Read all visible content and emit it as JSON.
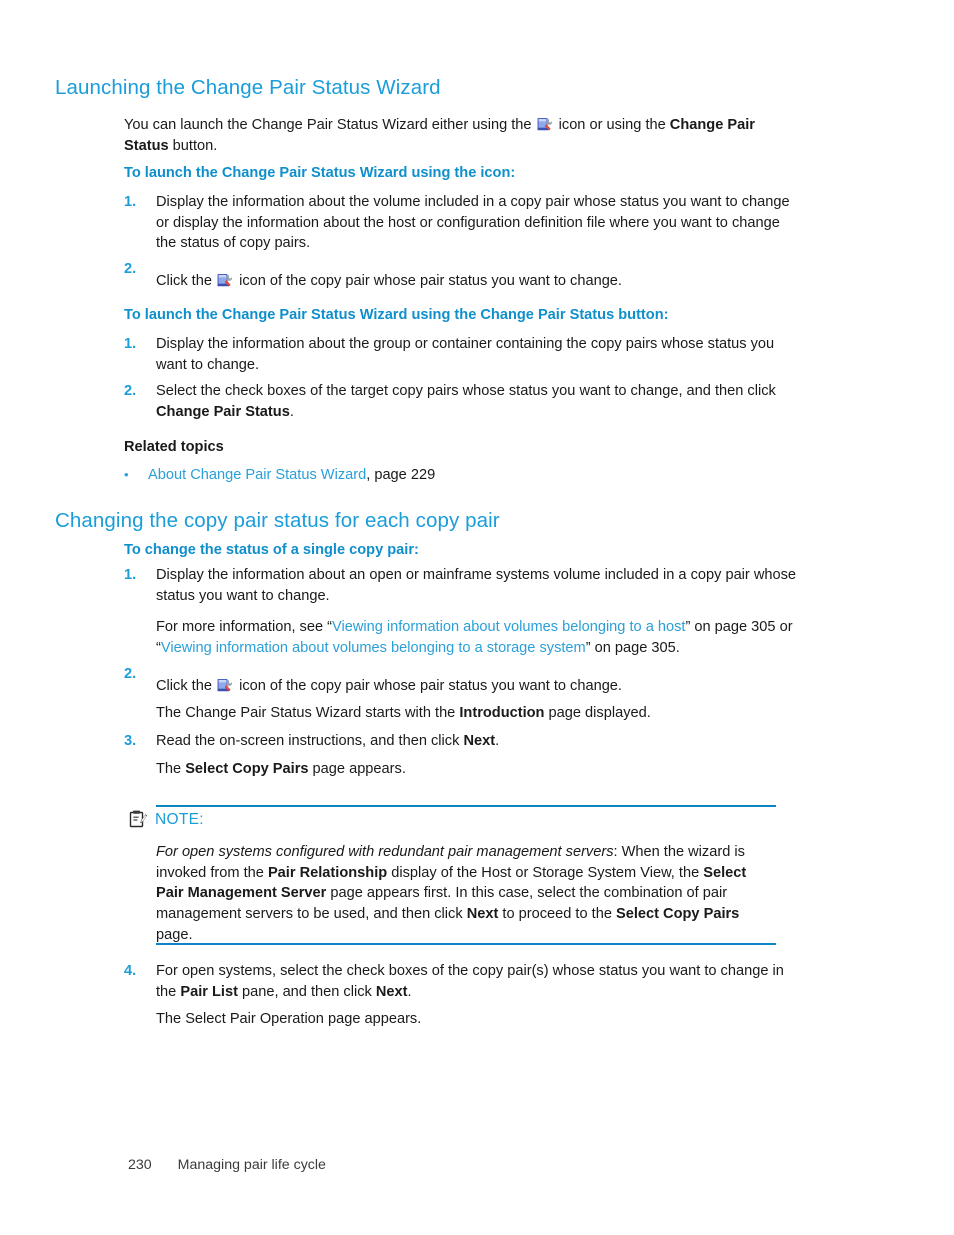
{
  "page": {
    "number": "230",
    "footer_title": "Managing pair life cycle",
    "accent_color": "#1a9dd9",
    "subheading_color": "#0f8fcc",
    "link_color": "#2a9fd8",
    "rule_color": "#0b86c2"
  },
  "section1": {
    "heading": "Launching the Change Pair Status Wizard",
    "intro": {
      "part1": "You can launch the Change Pair Status Wizard either using the ",
      "icon": "change-pair-status-wizard-icon",
      "part2": " icon or using the ",
      "bold": "Change Pair Status",
      "part3": " button."
    },
    "sub1": {
      "heading": "To launch the Change Pair Status Wizard using the icon:",
      "steps": [
        {
          "num": "1.",
          "text": "Display the information about the volume included in a copy pair whose status you want to change or display the information about the host or configuration definition file where you want to change the status of copy pairs."
        },
        {
          "num": "2.",
          "pre": "Click the ",
          "icon": "change-pair-status-wizard-icon",
          "post": " icon of the copy pair whose pair status you want to change."
        }
      ]
    },
    "sub2": {
      "heading": "To launch the Change Pair Status Wizard using the Change Pair Status button:",
      "steps": [
        {
          "num": "1.",
          "text": "Display the information about the group or container containing the copy pairs whose status you want to change."
        },
        {
          "num": "2.",
          "pre": "Select the check boxes of the target copy pairs whose status you want to change, and then click ",
          "bold": "Change Pair Status",
          "post": "."
        }
      ]
    },
    "related": {
      "heading": "Related topics",
      "bullet": "•",
      "link": "About Change Pair Status Wizard",
      "suffix": ", page 229"
    }
  },
  "section2": {
    "heading": "Changing the copy pair status for each copy pair",
    "sub_heading": "To change the status of a single copy pair:",
    "steps": [
      {
        "num": "1.",
        "text": "Display the information about an open or mainframe systems volume included in a copy pair whose status you want to change.",
        "followup": {
          "pre": "For more information, see “",
          "link1": "Viewing information about volumes belonging to a host",
          "mid": "” on page 305 or “",
          "link2": "Viewing information about volumes belonging to a storage system",
          "post": "” on page 305."
        }
      },
      {
        "num": "2.",
        "pre": "Click the ",
        "icon": "change-pair-status-wizard-icon",
        "post": " icon of the copy pair whose pair status you want to change.",
        "followup": {
          "pre": "The Change Pair Status Wizard starts with the ",
          "bold": "Introduction",
          "post": " page displayed."
        }
      },
      {
        "num": "3.",
        "pre": "Read the on-screen instructions, and then click ",
        "bold": "Next",
        "post": ".",
        "followup": {
          "pre": "The ",
          "bold": "Select Copy Pairs",
          "post": " page appears."
        }
      },
      {
        "num": "4.",
        "pre": "For open systems, select the check boxes of the copy pair(s) whose status you want to change in the ",
        "bold": "Pair List",
        "mid": " pane, and then click ",
        "bold2": "Next",
        "post": ".",
        "followup": {
          "pre": "The Select Pair Operation page appears."
        }
      }
    ]
  },
  "note": {
    "icon": "note-clipboard-icon",
    "title": "NOTE:",
    "text": {
      "p1_italic": "For open systems configured with redundant pair management servers",
      "p1_a": ": When the wizard is invoked from the ",
      "p1_b_bold": "Pair Relationship",
      "p1_c": " display of the Host or Storage System View, the ",
      "p1_d_bold": "Select Pair Management Server",
      "p1_e": " page appears first. In this case, select the combination of pair management servers to be used, and then click ",
      "p1_f_bold": "Next",
      "p1_g": " to proceed to the ",
      "p1_h_bold": "Select Copy Pairs",
      "p1_i": " page."
    }
  }
}
